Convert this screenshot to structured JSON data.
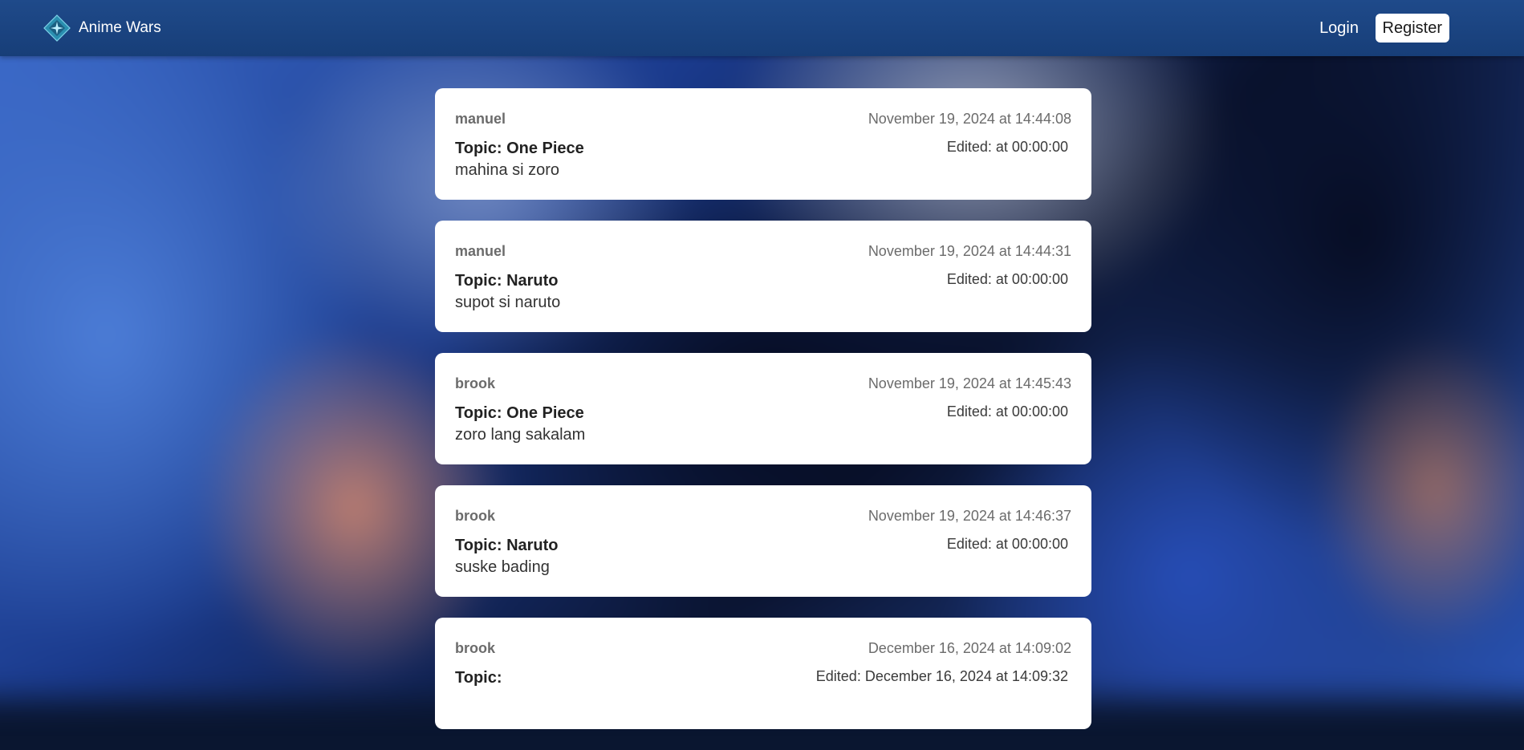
{
  "navbar": {
    "brand_name": "Anime Wars",
    "brand_icon": "anime-wars-logo",
    "login_label": "Login",
    "register_label": "Register"
  },
  "posts": [
    {
      "username": "manuel",
      "date": "November 19, 2024 at 14:44:08",
      "topic": "Topic: One Piece",
      "edited": "Edited: at 00:00:00",
      "content": "mahina si zoro"
    },
    {
      "username": "manuel",
      "date": "November 19, 2024 at 14:44:31",
      "topic": "Topic: Naruto",
      "edited": "Edited: at 00:00:00",
      "content": "supot si naruto"
    },
    {
      "username": "brook",
      "date": "November 19, 2024 at 14:45:43",
      "topic": "Topic: One Piece",
      "edited": "Edited: at 00:00:00",
      "content": "zoro lang sakalam"
    },
    {
      "username": "brook",
      "date": "November 19, 2024 at 14:46:37",
      "topic": "Topic: Naruto",
      "edited": "Edited: at 00:00:00",
      "content": "suske bading"
    },
    {
      "username": "brook",
      "date": "December 16, 2024 at 14:09:02",
      "topic": "Topic:",
      "edited": "Edited: December 16, 2024 at 14:09:32",
      "content": ""
    }
  ],
  "colors": {
    "navbar": "#1f4a8a",
    "card": "#ffffff",
    "muted_text": "#6b6b6b"
  }
}
